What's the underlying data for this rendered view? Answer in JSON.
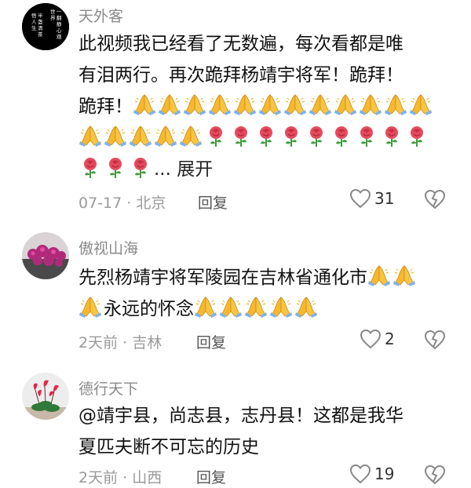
{
  "comments": [
    {
      "username": "天外客",
      "avatar_text": "一翻静心观世界 半盏清茶悟人生",
      "text1": "此视频我已经看了无数遍，每次看都是唯",
      "text2": "有泪两行。再次跪拜杨靖宇将军！跪拜！",
      "text3": "跪拜！",
      "expand_label": "... 展开",
      "date": "07-17",
      "location": "北京",
      "reply_label": "回复",
      "likes": "31"
    },
    {
      "username": "傲视山海",
      "text1": "先烈杨靖宇将军陵园在吉林省通化市",
      "text2": "永远的怀念",
      "date": "2天前",
      "location": "吉林",
      "reply_label": "回复",
      "likes": "2"
    },
    {
      "username": "德行天下",
      "text1": "@靖宇县，尚志县，志丹县！这都是我华",
      "text2": "夏匹夫断不可忘的历史",
      "date": "2天前",
      "location": "山西",
      "reply_label": "回复",
      "likes": "19"
    }
  ],
  "separator": " · ",
  "colors": {
    "pray": "#F5B82E",
    "rose": "#E64A5C",
    "stem": "#3E9B3E",
    "icon": "#888888"
  }
}
